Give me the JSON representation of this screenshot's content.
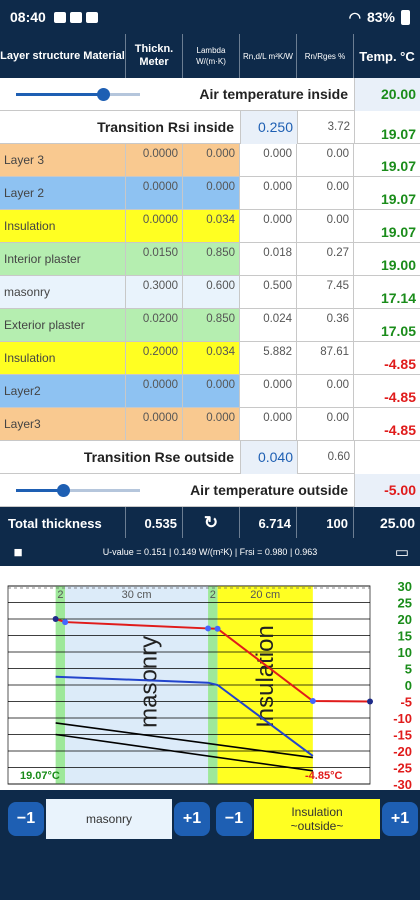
{
  "status": {
    "time": "08:40",
    "battery": "83%"
  },
  "header": {
    "col1": "Layer structure Material",
    "col2": "Thickn. Meter",
    "col3": "Lambda W/(m·K)",
    "col4": "Rn,d/L m²K/W",
    "col5": "Rn/Rges %",
    "col6": "Temp. °C"
  },
  "air_inside": {
    "label": "Air temperature inside",
    "temp": "20.00",
    "slider_fraction": 0.7
  },
  "rsi": {
    "label": "Transition Rsi inside",
    "value": "0.250",
    "percent": "3.72",
    "temp": "19.07"
  },
  "layers": [
    {
      "name": "Layer 3",
      "thickness": "0.0000",
      "lambda": "0.000",
      "r": "0.000",
      "percent": "0.00",
      "temp": "19.07",
      "color": "#f9c990",
      "temp_color": "green"
    },
    {
      "name": "Layer 2",
      "thickness": "0.0000",
      "lambda": "0.000",
      "r": "0.000",
      "percent": "0.00",
      "temp": "19.07",
      "color": "#8ec2f2",
      "temp_color": "green"
    },
    {
      "name": "Insulation",
      "thickness": "0.0000",
      "lambda": "0.034",
      "r": "0.000",
      "percent": "0.00",
      "temp": "19.07",
      "color": "#ffff22",
      "temp_color": "green"
    },
    {
      "name": "Interior plaster",
      "thickness": "0.0150",
      "lambda": "0.850",
      "r": "0.018",
      "percent": "0.27",
      "temp": "19.00",
      "color": "#b5eeb0",
      "temp_color": "green"
    },
    {
      "name": "masonry",
      "thickness": "0.3000",
      "lambda": "0.600",
      "r": "0.500",
      "percent": "7.45",
      "temp": "17.14",
      "color": "#e9f3fc",
      "temp_color": "green"
    },
    {
      "name": "Exterior plaster",
      "thickness": "0.0200",
      "lambda": "0.850",
      "r": "0.024",
      "percent": "0.36",
      "temp": "17.05",
      "color": "#b5eeb0",
      "temp_color": "green"
    },
    {
      "name": "Insulation",
      "thickness": "0.2000",
      "lambda": "0.034",
      "r": "5.882",
      "percent": "87.61",
      "temp": "-4.85",
      "color": "#ffff22",
      "temp_color": "red"
    },
    {
      "name": "Layer2",
      "thickness": "0.0000",
      "lambda": "0.000",
      "r": "0.000",
      "percent": "0.00",
      "temp": "-4.85",
      "color": "#8ec2f2",
      "temp_color": "red"
    },
    {
      "name": "Layer3",
      "thickness": "0.0000",
      "lambda": "0.000",
      "r": "0.000",
      "percent": "0.00",
      "temp": "-4.85",
      "color": "#f9c990",
      "temp_color": "red"
    }
  ],
  "rse": {
    "label": "Transition Rse outside",
    "value": "0.040",
    "percent": "0.60"
  },
  "air_outside": {
    "label": "Air temperature outside",
    "temp": "-5.00",
    "slider_fraction": 0.38
  },
  "totals": {
    "label": "Total thickness",
    "thickness": "0.535",
    "r_total": "6.714",
    "percent": "100",
    "temp": "25.00"
  },
  "uvalue_text": "U-value = 0.151 | 0.149 W/(m²K) | Frsi = 0.980 | 0.963",
  "chart_data": {
    "type": "line",
    "ylim": [
      -30,
      30
    ],
    "yticks": [
      30,
      25,
      20,
      15,
      10,
      5,
      0,
      -5,
      -10,
      -15,
      -20,
      -25,
      -30
    ],
    "layer_labels": [
      "2",
      "30 cm",
      "2",
      "20 cm"
    ],
    "region_labels": [
      "masonry",
      "Insulation"
    ],
    "inside_label": "19.07°C",
    "outside_label": "-4.85°C",
    "series": [
      {
        "color": "#e01b1b",
        "x": [
          0,
          2.0,
          32.0,
          34.0,
          54.0,
          66.0
        ],
        "y": [
          20.0,
          19.07,
          17.14,
          17.05,
          -4.85,
          -5.0
        ]
      }
    ]
  },
  "controls": {
    "left_minus": "−1",
    "left_label": "masonry",
    "left_plus": "+1",
    "right_minus": "−1",
    "right_label_line1": "Insulation",
    "right_label_line2": "~outside~",
    "right_plus": "+1"
  }
}
